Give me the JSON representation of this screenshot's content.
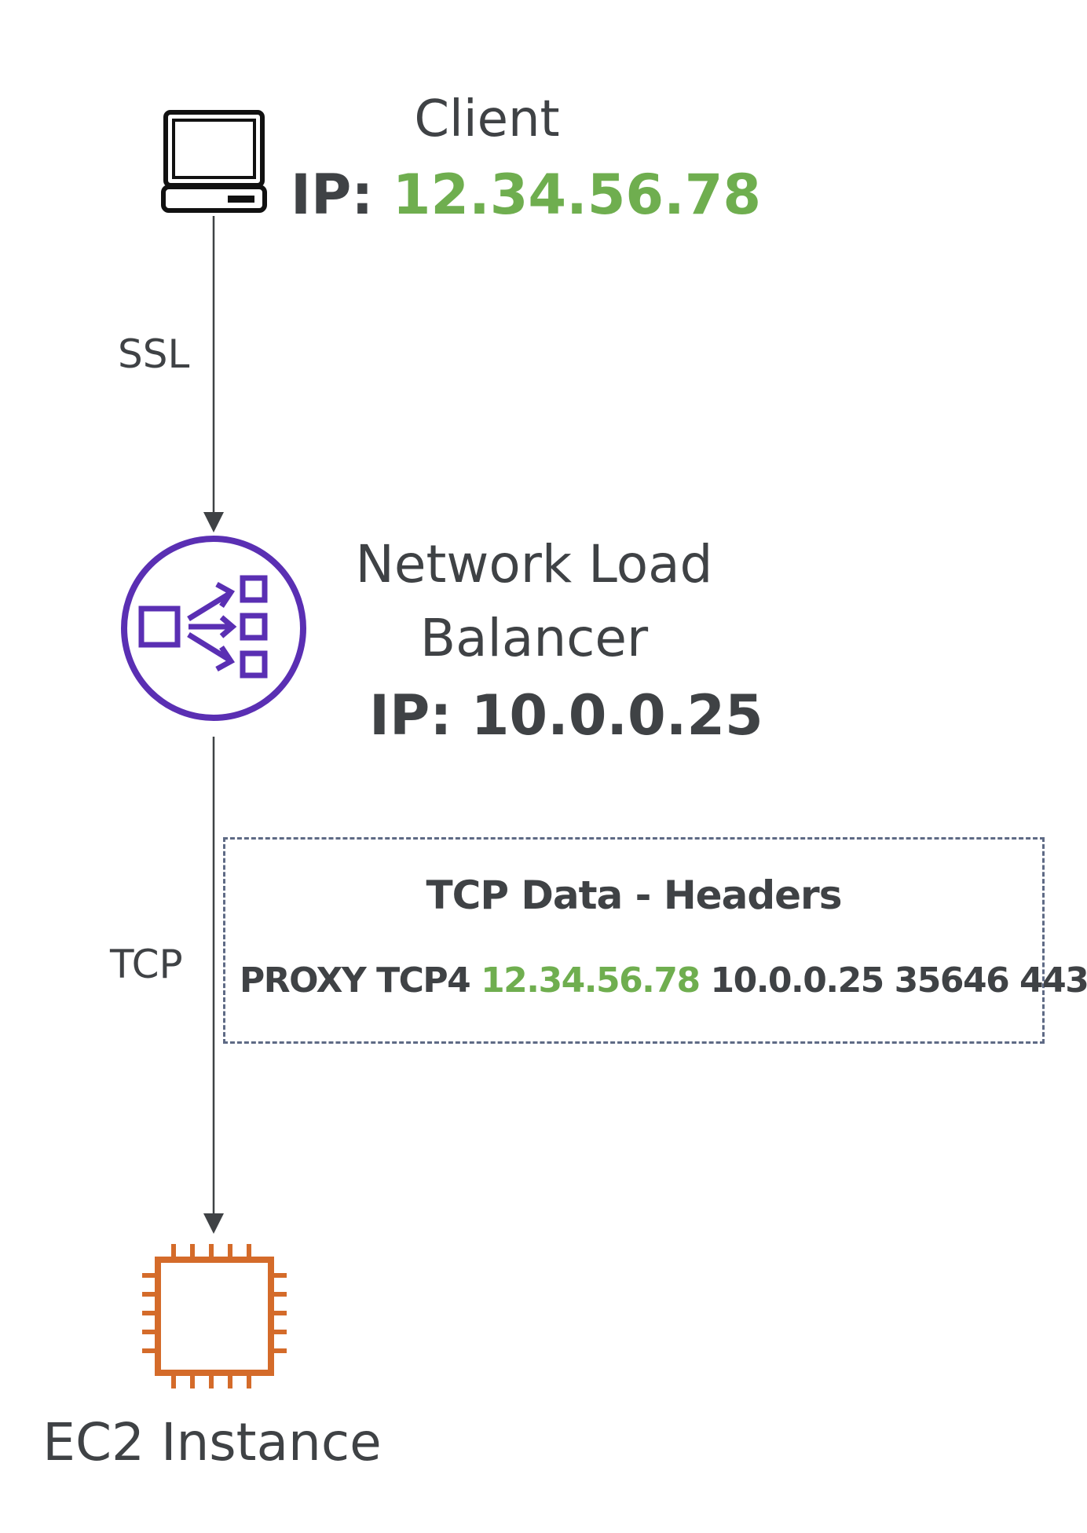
{
  "client": {
    "name": "Client",
    "ip_label": "IP: ",
    "ip_value": "12.34.56.78"
  },
  "edges": {
    "client_to_nlb": "SSL",
    "nlb_to_ec2": "TCP"
  },
  "load_balancer": {
    "name_line1": "Network Load",
    "name_line2": "Balancer",
    "ip_label": "IP: ",
    "ip_value": "10.0.0.25"
  },
  "tcp_header_box": {
    "title": "TCP Data - Headers",
    "prefix": "PROXY TCP4 ",
    "source_ip": "12.34.56.78",
    "rest": " 10.0.0.25 35646 443"
  },
  "ec2": {
    "name": "EC2 Instance"
  },
  "colors": {
    "text": "#3f4245",
    "ip_highlight": "#6fae4f",
    "nlb_icon": "#5a2fb3",
    "ec2_icon": "#d46b2a",
    "box_border": "#5e6a85"
  },
  "icons": {
    "client": "laptop-icon",
    "load_balancer": "network-load-balancer-icon",
    "ec2": "ec2-chip-icon"
  }
}
